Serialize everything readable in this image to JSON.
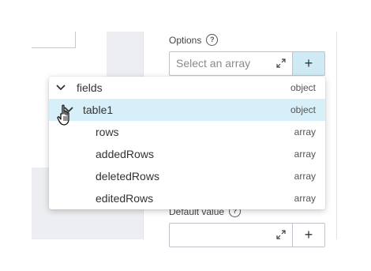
{
  "panel": {
    "options_label": "Options",
    "options_placeholder": "Select an array",
    "add_symbol": "+",
    "help_symbol": "?",
    "default_label": "Default value"
  },
  "dropdown": {
    "items": [
      {
        "label": "fields",
        "type": "object",
        "expanded": true,
        "selected": false
      },
      {
        "label": "table1",
        "type": "object",
        "expanded": true,
        "selected": true
      },
      {
        "label": "rows",
        "type": "array"
      },
      {
        "label": "addedRows",
        "type": "array"
      },
      {
        "label": "deletedRows",
        "type": "array"
      },
      {
        "label": "editedRows",
        "type": "array"
      }
    ]
  },
  "colors": {
    "selected_row": "#d7eff8",
    "active_button": "#cfeaf5"
  }
}
